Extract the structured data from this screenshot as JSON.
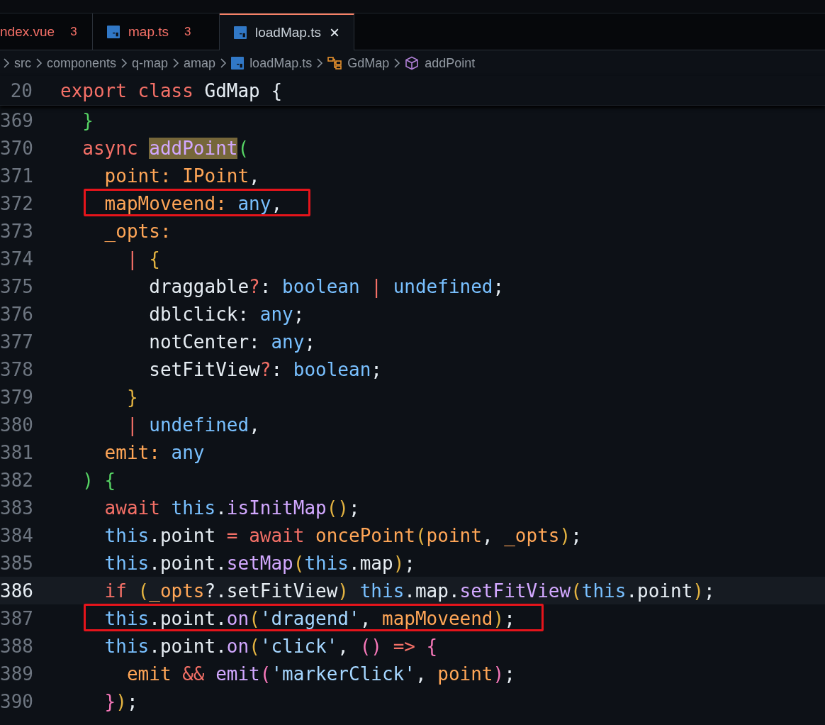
{
  "tabs": [
    {
      "kind": "vue",
      "label": "ndex.vue",
      "badge": "3",
      "problems": true,
      "selected": false
    },
    {
      "kind": "ts",
      "label": "map.ts",
      "badge": "3",
      "problems": true,
      "selected": false
    },
    {
      "kind": "ts",
      "label": "loadMap.ts",
      "close": "×",
      "problems": false,
      "selected": true
    }
  ],
  "breadcrumb": [
    {
      "label": "src",
      "kind": "folder"
    },
    {
      "label": "components",
      "kind": "folder"
    },
    {
      "label": "q-map",
      "kind": "folder"
    },
    {
      "label": "amap",
      "kind": "folder"
    },
    {
      "label": "loadMap.ts",
      "kind": "ts-file"
    },
    {
      "label": "GdMap",
      "kind": "class"
    },
    {
      "label": "addPoint",
      "kind": "method"
    }
  ],
  "sticky_line": {
    "number": "20",
    "tokens": [
      {
        "t": "export class ",
        "kind": "kw"
      },
      {
        "t": "GdMap {",
        "kind": "punc"
      }
    ]
  },
  "lines": [
    {
      "number": "369",
      "current": false,
      "boxed": false,
      "tokens": [
        {
          "t": "  }",
          "kind": "bgreen"
        }
      ]
    },
    {
      "number": "370",
      "current": false,
      "boxed": false,
      "tokens": [
        {
          "t": "  async ",
          "kind": "kw"
        },
        {
          "t": "addPoint",
          "kind": "fn",
          "highlighted": true
        },
        {
          "t": "(",
          "kind": "bgreen"
        }
      ]
    },
    {
      "number": "371",
      "current": false,
      "boxed": false,
      "tokens": [
        {
          "t": "    point: IPoint",
          "kind": "param"
        },
        {
          "t": ",",
          "kind": "punc"
        }
      ]
    },
    {
      "number": "372",
      "current": false,
      "boxed": true,
      "tokens": [
        {
          "t": "    mapMoveend: ",
          "kind": "param"
        },
        {
          "t": "any",
          "kind": "type"
        },
        {
          "t": ",",
          "kind": "punc"
        }
      ]
    },
    {
      "number": "373",
      "current": false,
      "boxed": false,
      "tokens": [
        {
          "t": "    _opts:",
          "kind": "param"
        }
      ]
    },
    {
      "number": "374",
      "current": false,
      "boxed": false,
      "tokens": [
        {
          "t": "      | ",
          "kind": "op"
        },
        {
          "t": "{",
          "kind": "byellow"
        }
      ]
    },
    {
      "number": "375",
      "current": false,
      "boxed": false,
      "tokens": [
        {
          "t": "        draggable",
          "kind": "punc"
        },
        {
          "t": "?",
          "kind": "op"
        },
        {
          "t": ": ",
          "kind": "punc"
        },
        {
          "t": "boolean",
          "kind": "type"
        },
        {
          "t": " | ",
          "kind": "op"
        },
        {
          "t": "undefined",
          "kind": "type"
        },
        {
          "t": ";",
          "kind": "punc"
        }
      ]
    },
    {
      "number": "376",
      "current": false,
      "boxed": false,
      "tokens": [
        {
          "t": "        dblclick: ",
          "kind": "punc"
        },
        {
          "t": "any",
          "kind": "type"
        },
        {
          "t": ";",
          "kind": "punc"
        }
      ]
    },
    {
      "number": "377",
      "current": false,
      "boxed": false,
      "tokens": [
        {
          "t": "        notCenter: ",
          "kind": "punc"
        },
        {
          "t": "any",
          "kind": "type"
        },
        {
          "t": ";",
          "kind": "punc"
        }
      ]
    },
    {
      "number": "378",
      "current": false,
      "boxed": false,
      "tokens": [
        {
          "t": "        setFitView",
          "kind": "punc"
        },
        {
          "t": "?",
          "kind": "op"
        },
        {
          "t": ": ",
          "kind": "punc"
        },
        {
          "t": "boolean",
          "kind": "type"
        },
        {
          "t": ";",
          "kind": "punc"
        }
      ]
    },
    {
      "number": "379",
      "current": false,
      "boxed": false,
      "tokens": [
        {
          "t": "      }",
          "kind": "byellow"
        }
      ]
    },
    {
      "number": "380",
      "current": false,
      "boxed": false,
      "tokens": [
        {
          "t": "      | ",
          "kind": "op"
        },
        {
          "t": "undefined",
          "kind": "type"
        },
        {
          "t": ",",
          "kind": "punc"
        }
      ]
    },
    {
      "number": "381",
      "current": false,
      "boxed": false,
      "tokens": [
        {
          "t": "    emit: ",
          "kind": "param"
        },
        {
          "t": "any",
          "kind": "type"
        }
      ]
    },
    {
      "number": "382",
      "current": false,
      "boxed": false,
      "tokens": [
        {
          "t": "  ) {",
          "kind": "bgreen"
        }
      ]
    },
    {
      "number": "383",
      "current": false,
      "boxed": false,
      "tokens": [
        {
          "t": "    await ",
          "kind": "kw"
        },
        {
          "t": "this",
          "kind": "this"
        },
        {
          "t": ".",
          "kind": "punc"
        },
        {
          "t": "isInitMap",
          "kind": "fn"
        },
        {
          "t": "()",
          "kind": "byellow"
        },
        {
          "t": ";",
          "kind": "punc"
        }
      ]
    },
    {
      "number": "384",
      "current": false,
      "boxed": false,
      "tokens": [
        {
          "t": "    this",
          "kind": "this"
        },
        {
          "t": ".point ",
          "kind": "punc"
        },
        {
          "t": "= ",
          "kind": "op"
        },
        {
          "t": "await ",
          "kind": "kw"
        },
        {
          "t": "oncePoint",
          "kind": "param"
        },
        {
          "t": "(",
          "kind": "byellow"
        },
        {
          "t": "point",
          "kind": "param"
        },
        {
          "t": ", ",
          "kind": "punc"
        },
        {
          "t": "_opts",
          "kind": "param"
        },
        {
          "t": ")",
          "kind": "byellow"
        },
        {
          "t": ";",
          "kind": "punc"
        }
      ]
    },
    {
      "number": "385",
      "current": false,
      "boxed": false,
      "tokens": [
        {
          "t": "    this",
          "kind": "this"
        },
        {
          "t": ".point.",
          "kind": "punc"
        },
        {
          "t": "setMap",
          "kind": "fn"
        },
        {
          "t": "(",
          "kind": "byellow"
        },
        {
          "t": "this",
          "kind": "this"
        },
        {
          "t": ".map",
          "kind": "punc"
        },
        {
          "t": ")",
          "kind": "byellow"
        },
        {
          "t": ";",
          "kind": "punc"
        }
      ]
    },
    {
      "number": "386",
      "current": true,
      "boxed": false,
      "tokens": [
        {
          "t": "    if ",
          "kind": "kw"
        },
        {
          "t": "(",
          "kind": "byellow"
        },
        {
          "t": "_opts",
          "kind": "param"
        },
        {
          "t": "?.setFitView",
          "kind": "punc"
        },
        {
          "t": ")",
          "kind": "byellow"
        },
        {
          "t": " this",
          "kind": "this"
        },
        {
          "t": ".map.",
          "kind": "punc"
        },
        {
          "t": "setFitView",
          "kind": "fn"
        },
        {
          "t": "(",
          "kind": "byellow"
        },
        {
          "t": "this",
          "kind": "this"
        },
        {
          "t": ".point",
          "kind": "punc"
        },
        {
          "t": ")",
          "kind": "byellow"
        },
        {
          "t": ";",
          "kind": "punc"
        }
      ]
    },
    {
      "number": "387",
      "current": false,
      "boxed": true,
      "tokens": [
        {
          "t": "    this",
          "kind": "this"
        },
        {
          "t": ".point.",
          "kind": "punc"
        },
        {
          "t": "on",
          "kind": "fn"
        },
        {
          "t": "(",
          "kind": "byellow"
        },
        {
          "t": "'dragend'",
          "kind": "str"
        },
        {
          "t": ", ",
          "kind": "punc"
        },
        {
          "t": "mapMoveend",
          "kind": "param"
        },
        {
          "t": ")",
          "kind": "byellow"
        },
        {
          "t": ";",
          "kind": "punc"
        }
      ]
    },
    {
      "number": "388",
      "current": false,
      "boxed": false,
      "tokens": [
        {
          "t": "    this",
          "kind": "this"
        },
        {
          "t": ".point.",
          "kind": "punc"
        },
        {
          "t": "on",
          "kind": "fn"
        },
        {
          "t": "(",
          "kind": "byellow"
        },
        {
          "t": "'click'",
          "kind": "str"
        },
        {
          "t": ", ",
          "kind": "punc"
        },
        {
          "t": "()",
          "kind": "bpink"
        },
        {
          "t": " => ",
          "kind": "op"
        },
        {
          "t": "{",
          "kind": "bpink"
        }
      ]
    },
    {
      "number": "389",
      "current": false,
      "boxed": false,
      "tokens": [
        {
          "t": "      emit ",
          "kind": "param"
        },
        {
          "t": "&& ",
          "kind": "op"
        },
        {
          "t": "emit",
          "kind": "fn"
        },
        {
          "t": "(",
          "kind": "bpink"
        },
        {
          "t": "'markerClick'",
          "kind": "str"
        },
        {
          "t": ", ",
          "kind": "punc"
        },
        {
          "t": "point",
          "kind": "param"
        },
        {
          "t": ")",
          "kind": "bpink"
        },
        {
          "t": ";",
          "kind": "punc"
        }
      ]
    },
    {
      "number": "390",
      "current": false,
      "boxed": false,
      "tokens": [
        {
          "t": "    }",
          "kind": "bpink"
        },
        {
          "t": ")",
          "kind": "byellow"
        },
        {
          "t": ";",
          "kind": "punc"
        }
      ]
    }
  ]
}
